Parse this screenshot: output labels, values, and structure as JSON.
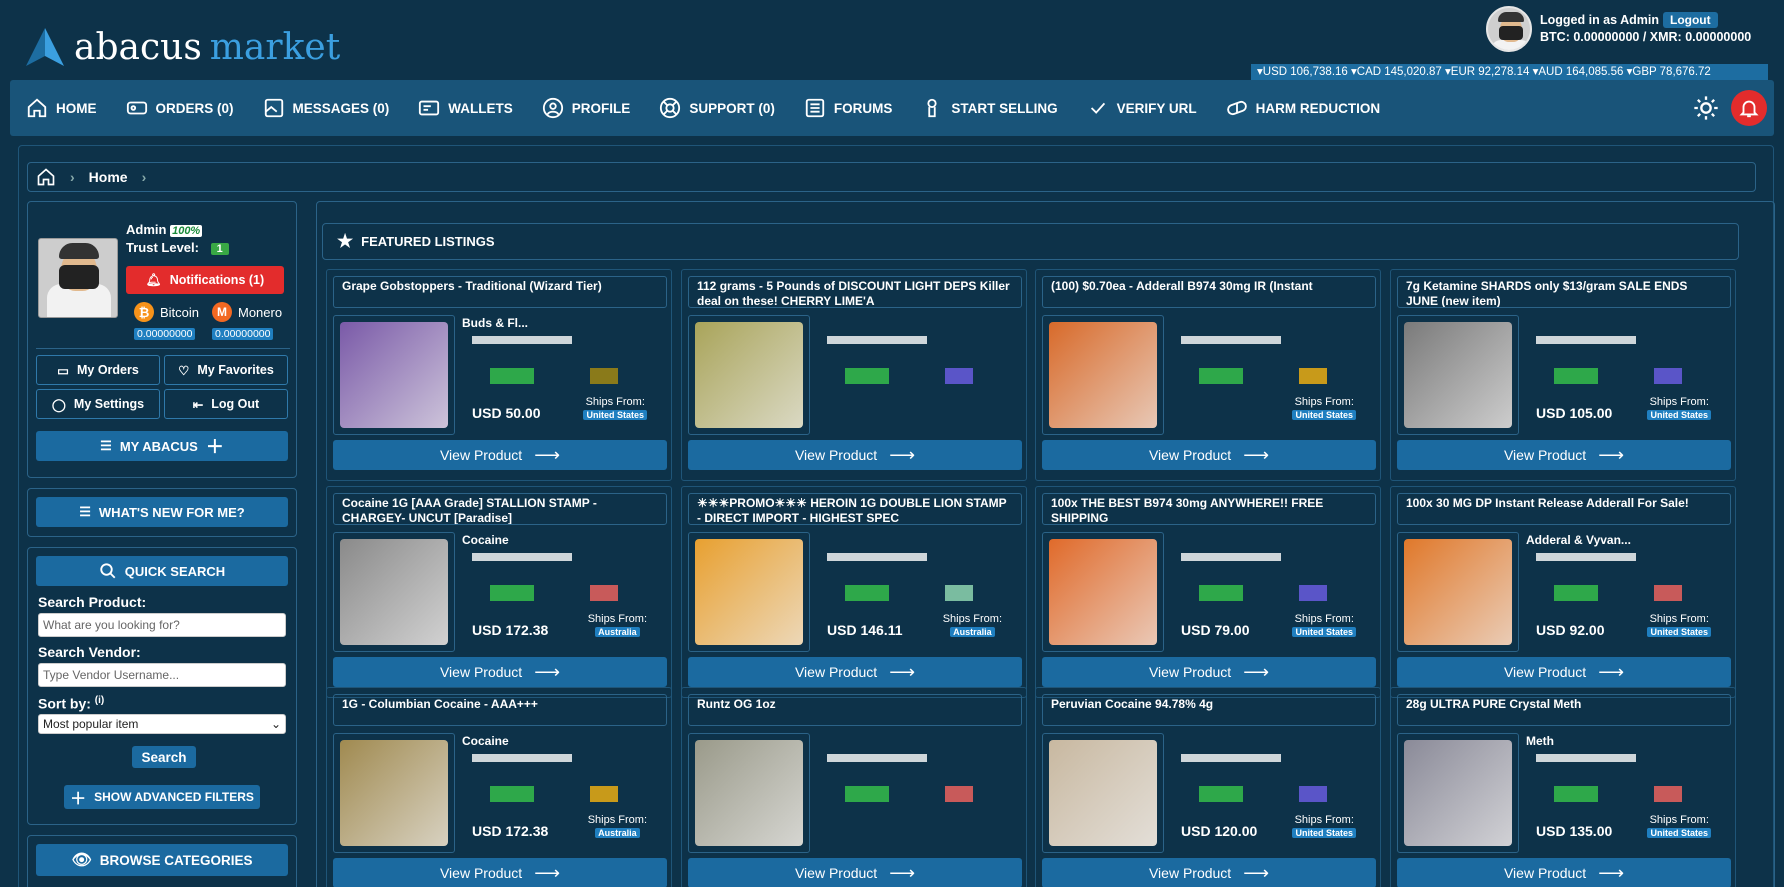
{
  "brand": {
    "word1": "abacus",
    "word2": "market"
  },
  "user": {
    "logged_in_as": "Logged in as Admin",
    "logout": "Logout",
    "balances": "BTC: 0.00000000 / XMR: 0.00000000"
  },
  "rates": "▾USD 106,738.16  ▾CAD 145,020.87  ▾EUR 92,278.14  ▾AUD 164,085.56  ▾GBP 78,676.72",
  "nav": [
    {
      "label": "HOME",
      "icon": "home-icon"
    },
    {
      "label": "ORDERS (0)",
      "icon": "orders-icon"
    },
    {
      "label": "MESSAGES (0)",
      "icon": "messages-icon"
    },
    {
      "label": "WALLETS",
      "icon": "wallet-icon"
    },
    {
      "label": "PROFILE",
      "icon": "profile-icon"
    },
    {
      "label": "SUPPORT (0)",
      "icon": "support-icon"
    },
    {
      "label": "FORUMS",
      "icon": "forums-icon"
    },
    {
      "label": "START SELLING",
      "icon": "selling-icon"
    },
    {
      "label": "VERIFY URL",
      "icon": "check-icon"
    },
    {
      "label": "HARM REDUCTION",
      "icon": "pill-icon"
    }
  ],
  "breadcrumb": {
    "current": "Home"
  },
  "profile": {
    "name": "Admin",
    "percent": "100%",
    "trust_label": "Trust Level:",
    "trust_value": "1",
    "notifications": "Notifications (1)",
    "btc_label": "Bitcoin",
    "btc_amount": "0.00000000",
    "xmr_label": "Monero",
    "xmr_amount": "0.00000000",
    "my_orders": "My Orders",
    "my_favorites": "My Favorites",
    "my_settings": "My Settings",
    "log_out": "Log Out",
    "my_abacus": "MY ABACUS"
  },
  "whats_new": "WHAT'S NEW FOR ME?",
  "search": {
    "title": "QUICK SEARCH",
    "product_label": "Search Product:",
    "product_placeholder": "What are you looking for?",
    "vendor_label": "Search Vendor:",
    "vendor_placeholder": "Type Vendor Username...",
    "sort_label": "Sort by:",
    "sort_info": "(i)",
    "sort_value": "Most popular item",
    "search_button": "Search",
    "advanced": "SHOW ADVANCED FILTERS"
  },
  "browse": {
    "title": "BROWSE CATEGORIES"
  },
  "featured": {
    "title": "FEATURED LISTINGS",
    "view_label": "View Product",
    "ships_label": "Ships From:"
  },
  "cards": [
    {
      "title": "Grape Gobstoppers - Traditional (Wizard Tier)",
      "vendor": "Buds & Fl...",
      "price": "USD 50.00",
      "ships": "United States",
      "img": "#7a5aa8",
      "c1": "#2ea84a",
      "c2": "#8a7a1a"
    },
    {
      "title": "112 grams - 5 Pounds of DISCOUNT LIGHT DEPS Killer deal on these! CHERRY LIME'A",
      "vendor": "",
      "price": "",
      "ships": "",
      "img": "#a9a45a",
      "c1": "#2ea84a",
      "c2": "#5a55c8"
    },
    {
      "title": "(100) $0.70ea - Adderall B974 30mg IR (Instant",
      "vendor": "",
      "price": "",
      "ships": "United States",
      "img": "#d86a2a",
      "c1": "#2ea84a",
      "c2": "#c89a1a"
    },
    {
      "title": "7g Ketamine SHARDS only $13/gram SALE ENDS JUNE (new item)",
      "vendor": "",
      "price": "USD 105.00",
      "ships": "United States",
      "img": "#7a7a7a",
      "c1": "#2ea84a",
      "c2": "#5a55c8"
    },
    {
      "title": "Cocaine 1G [AAA Grade] STALLION STAMP - CHARGEY- UNCUT [Paradise]",
      "vendor": "Cocaine",
      "price": "USD 172.38",
      "ships": "Australia",
      "img": "#8a8a8a",
      "c1": "#2ea84a",
      "c2": "#c85a5a"
    },
    {
      "title": "☀☀☀PROMO☀☀☀ HEROIN 1G DOUBLE LION STAMP - DIRECT IMPORT - HIGHEST SPEC",
      "vendor": "",
      "price": "USD 146.11",
      "ships": "Australia",
      "img": "#e8a030",
      "c1": "#2ea84a",
      "c2": "#7abca0"
    },
    {
      "title": "100x THE BEST B974 30mg ANYWHERE!! FREE SHIPPING",
      "vendor": "",
      "price": "USD 79.00",
      "ships": "United States",
      "img": "#e06a2a",
      "c1": "#2ea84a",
      "c2": "#5a55c8"
    },
    {
      "title": "100x 30 MG DP Instant Release Adderall For Sale!",
      "vendor": "Adderal & Vyvan...",
      "price": "USD 92.00",
      "ships": "United States",
      "img": "#e0782a",
      "c1": "#2ea84a",
      "c2": "#c85a5a"
    },
    {
      "title": "1G - Columbian Cocaine - AAA+++",
      "vendor": "Cocaine",
      "price": "USD 172.38",
      "ships": "Australia",
      "img": "#a08a50",
      "c1": "#2ea84a",
      "c2": "#c89a1a"
    },
    {
      "title": "Runtz OG 1oz",
      "vendor": "",
      "price": "",
      "ships": "",
      "img": "#9a9a8a",
      "c1": "#2ea84a",
      "c2": "#c85a5a"
    },
    {
      "title": "Peruvian Cocaine 94.78% 4g",
      "vendor": "",
      "price": "USD 120.00",
      "ships": "United States",
      "img": "#c8b8a0",
      "c1": "#2ea84a",
      "c2": "#5a55c8"
    },
    {
      "title": "28g ULTRA PURE Crystal Meth",
      "vendor": "Meth",
      "price": "USD 135.00",
      "ships": "United States",
      "img": "#8a8a98",
      "c1": "#2ea84a",
      "c2": "#c85a5a"
    }
  ]
}
